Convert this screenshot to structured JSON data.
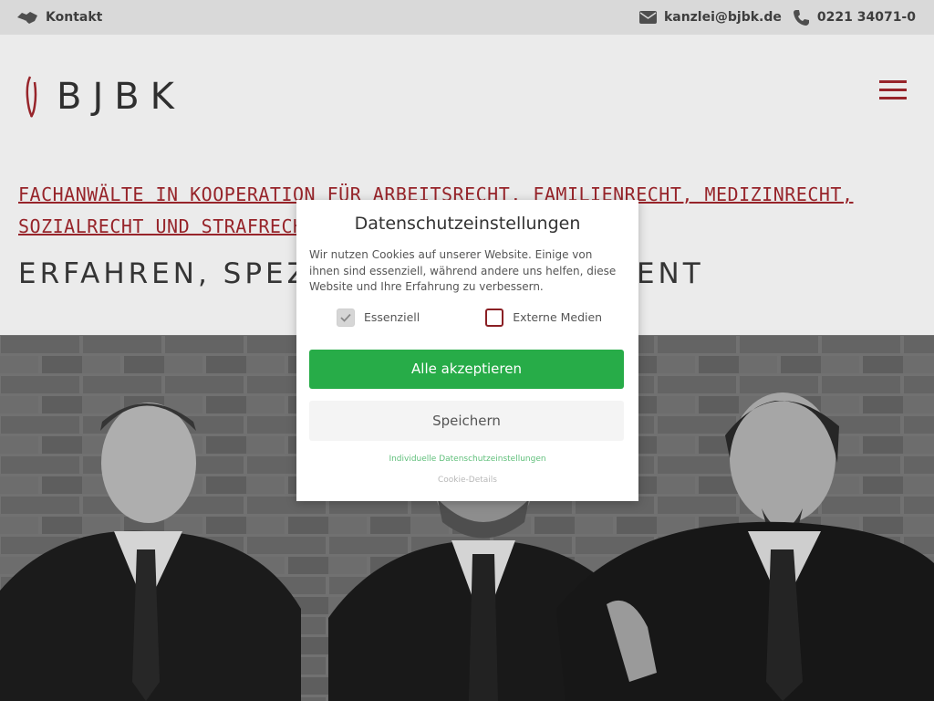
{
  "topbar": {
    "contact_label": "Kontakt",
    "email": "kanzlei@bjbk.de",
    "phone": "0221 34071-0",
    "icons": {
      "contact": "handshake-icon",
      "email": "envelope-icon",
      "phone": "phone-icon"
    }
  },
  "header": {
    "logo_text": "BJBK",
    "menu_icon": "hamburger-menu-icon"
  },
  "hero_text": {
    "tagline": "FACHANWÄLTE IN KOOPERATION FÜR ARBEITSRECHT, FAMILIENRECHT, MEDIZINRECHT, SOZIALRECHT UND STRAFRECHT",
    "subline": "ERFAHREN, SPEZIALISIERT, KOMPETENT"
  },
  "cookie_modal": {
    "title": "Datenschutzeinstellungen",
    "text": "Wir nutzen Cookies auf unserer Website. Einige von ihnen sind essenziell, während andere uns helfen, diese Website und Ihre Erfahrung zu verbessern.",
    "options": [
      {
        "label": "Essenziell",
        "checked": true,
        "disabled": true
      },
      {
        "label": "Externe Medien",
        "checked": false,
        "disabled": false
      }
    ],
    "accept_all_label": "Alle akzeptieren",
    "save_label": "Speichern",
    "individual_link": "Individuelle Datenschutzeinstellungen",
    "details_link": "Cookie-Details"
  },
  "colors": {
    "brand_red": "#a4282e",
    "accept_green": "#27ac48",
    "topbar_bg": "#ececec"
  }
}
